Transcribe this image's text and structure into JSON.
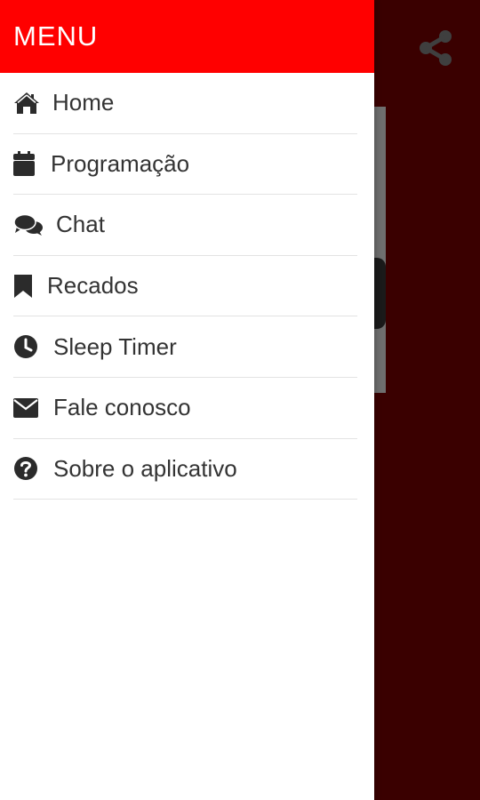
{
  "drawer": {
    "title": "MENU",
    "items": [
      {
        "label": "Home",
        "icon": "home-icon"
      },
      {
        "label": "Programação",
        "icon": "calendar-icon"
      },
      {
        "label": "Chat",
        "icon": "chat-bubbles-icon"
      },
      {
        "label": "Recados",
        "icon": "bookmark-icon"
      },
      {
        "label": "Sleep Timer",
        "icon": "clock-icon"
      },
      {
        "label": "Fale conosco",
        "icon": "envelope-icon"
      },
      {
        "label": "Sobre o aplicativo",
        "icon": "question-circle-icon"
      }
    ]
  },
  "toolbar": {
    "share_icon": "share-icon"
  },
  "colors": {
    "header": "#ff0000",
    "app_background": "#3a0000",
    "text": "#333333",
    "icon": "#2b2b2b",
    "divider": "#e3e3e3"
  }
}
